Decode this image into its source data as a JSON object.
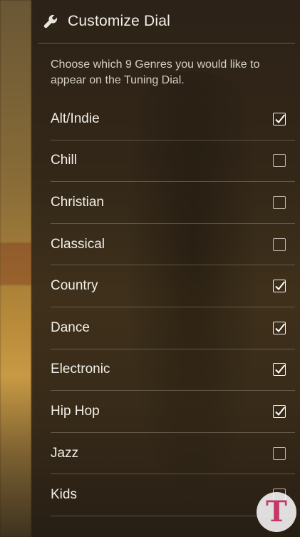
{
  "header": {
    "title": "Customize Dial",
    "icon": "wrench-icon"
  },
  "intro": "Choose which 9 Genres you would like to appear on the Tuning Dial.",
  "genres": [
    {
      "label": "Alt/Indie",
      "checked": true
    },
    {
      "label": "Chill",
      "checked": false
    },
    {
      "label": "Christian",
      "checked": false
    },
    {
      "label": "Classical",
      "checked": false
    },
    {
      "label": "Country",
      "checked": true
    },
    {
      "label": "Dance",
      "checked": true
    },
    {
      "label": "Electronic",
      "checked": true
    },
    {
      "label": "Hip Hop",
      "checked": true
    },
    {
      "label": "Jazz",
      "checked": false
    },
    {
      "label": "Kids",
      "checked": false
    }
  ],
  "watermark": {
    "glyph": "T",
    "color": "#c4376a"
  }
}
